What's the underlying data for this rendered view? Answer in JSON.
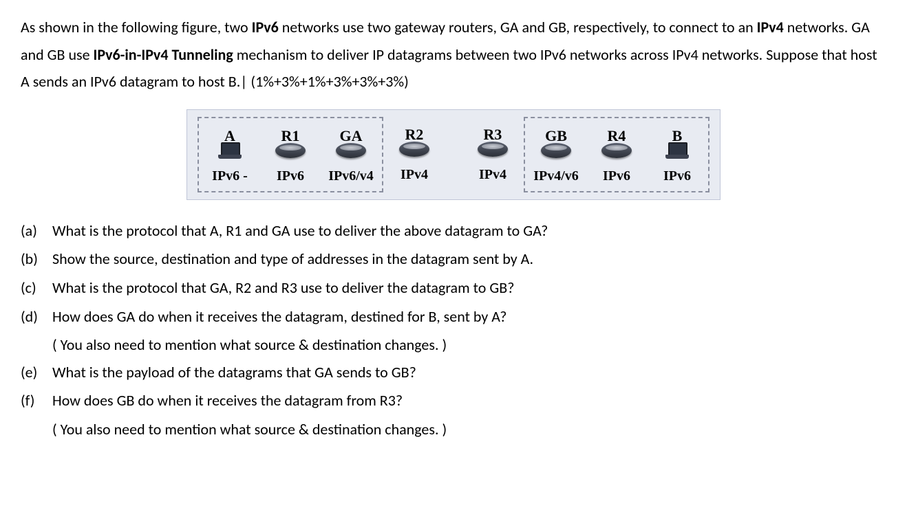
{
  "intro": {
    "p1_a": "As shown in the following figure, two ",
    "p1_b": "IPv6",
    "p1_c": " networks use two gateway routers, GA and GB, respectively, to connect to an ",
    "p1_d": "IPv4",
    "p1_e": " networks. GA and GB use ",
    "p1_f": "IPv6-in-IPv4 Tunneling",
    "p1_g": " mechanism to deliver IP datagrams between two IPv6 networks across IPv4 networks. Suppose that host A sends an IPv6 datagram to host B.| (1%+3%+1%+3%+3%+3%)"
  },
  "figure": {
    "left": [
      {
        "top": "A",
        "bottom": "IPv6 -",
        "icon": "laptop"
      },
      {
        "top": "R1",
        "bottom": "IPv6",
        "icon": "router"
      },
      {
        "top": "GA",
        "bottom": "IPv6/v4",
        "icon": "router"
      }
    ],
    "mid": [
      {
        "top": "R2",
        "bottom": "IPv4",
        "icon": "router"
      },
      {
        "top": "R3",
        "bottom": "IPv4",
        "icon": "router"
      }
    ],
    "right": [
      {
        "top": "GB",
        "bottom": "IPv4/v6",
        "icon": "router"
      },
      {
        "top": "R4",
        "bottom": "IPv6",
        "icon": "router"
      },
      {
        "top": "B",
        "bottom": "IPv6",
        "icon": "laptop"
      }
    ]
  },
  "questions": {
    "a": {
      "label": "(a)",
      "text": "What is the protocol that A, R1 and GA use to deliver the above datagram to GA?"
    },
    "b": {
      "label": "(b)",
      "text": "Show the source, destination and type of addresses in the datagram sent by A."
    },
    "c": {
      "label": "(c)",
      "text": "What is the protocol that GA, R2 and R3 use to deliver the datagram to GB?"
    },
    "d": {
      "label": "(d)",
      "text": "How does GA do when it receives the datagram, destined for B, sent by A?",
      "sub": "( You also need to mention what source & destination changes. )"
    },
    "e": {
      "label": "(e)",
      "text": "What is the payload of the datagrams that GA sends to GB?"
    },
    "f": {
      "label": "(f)",
      "text": "How does GB do when it receives the datagram from R3?",
      "sub": "( You also need to mention what source & destination changes. )"
    }
  }
}
